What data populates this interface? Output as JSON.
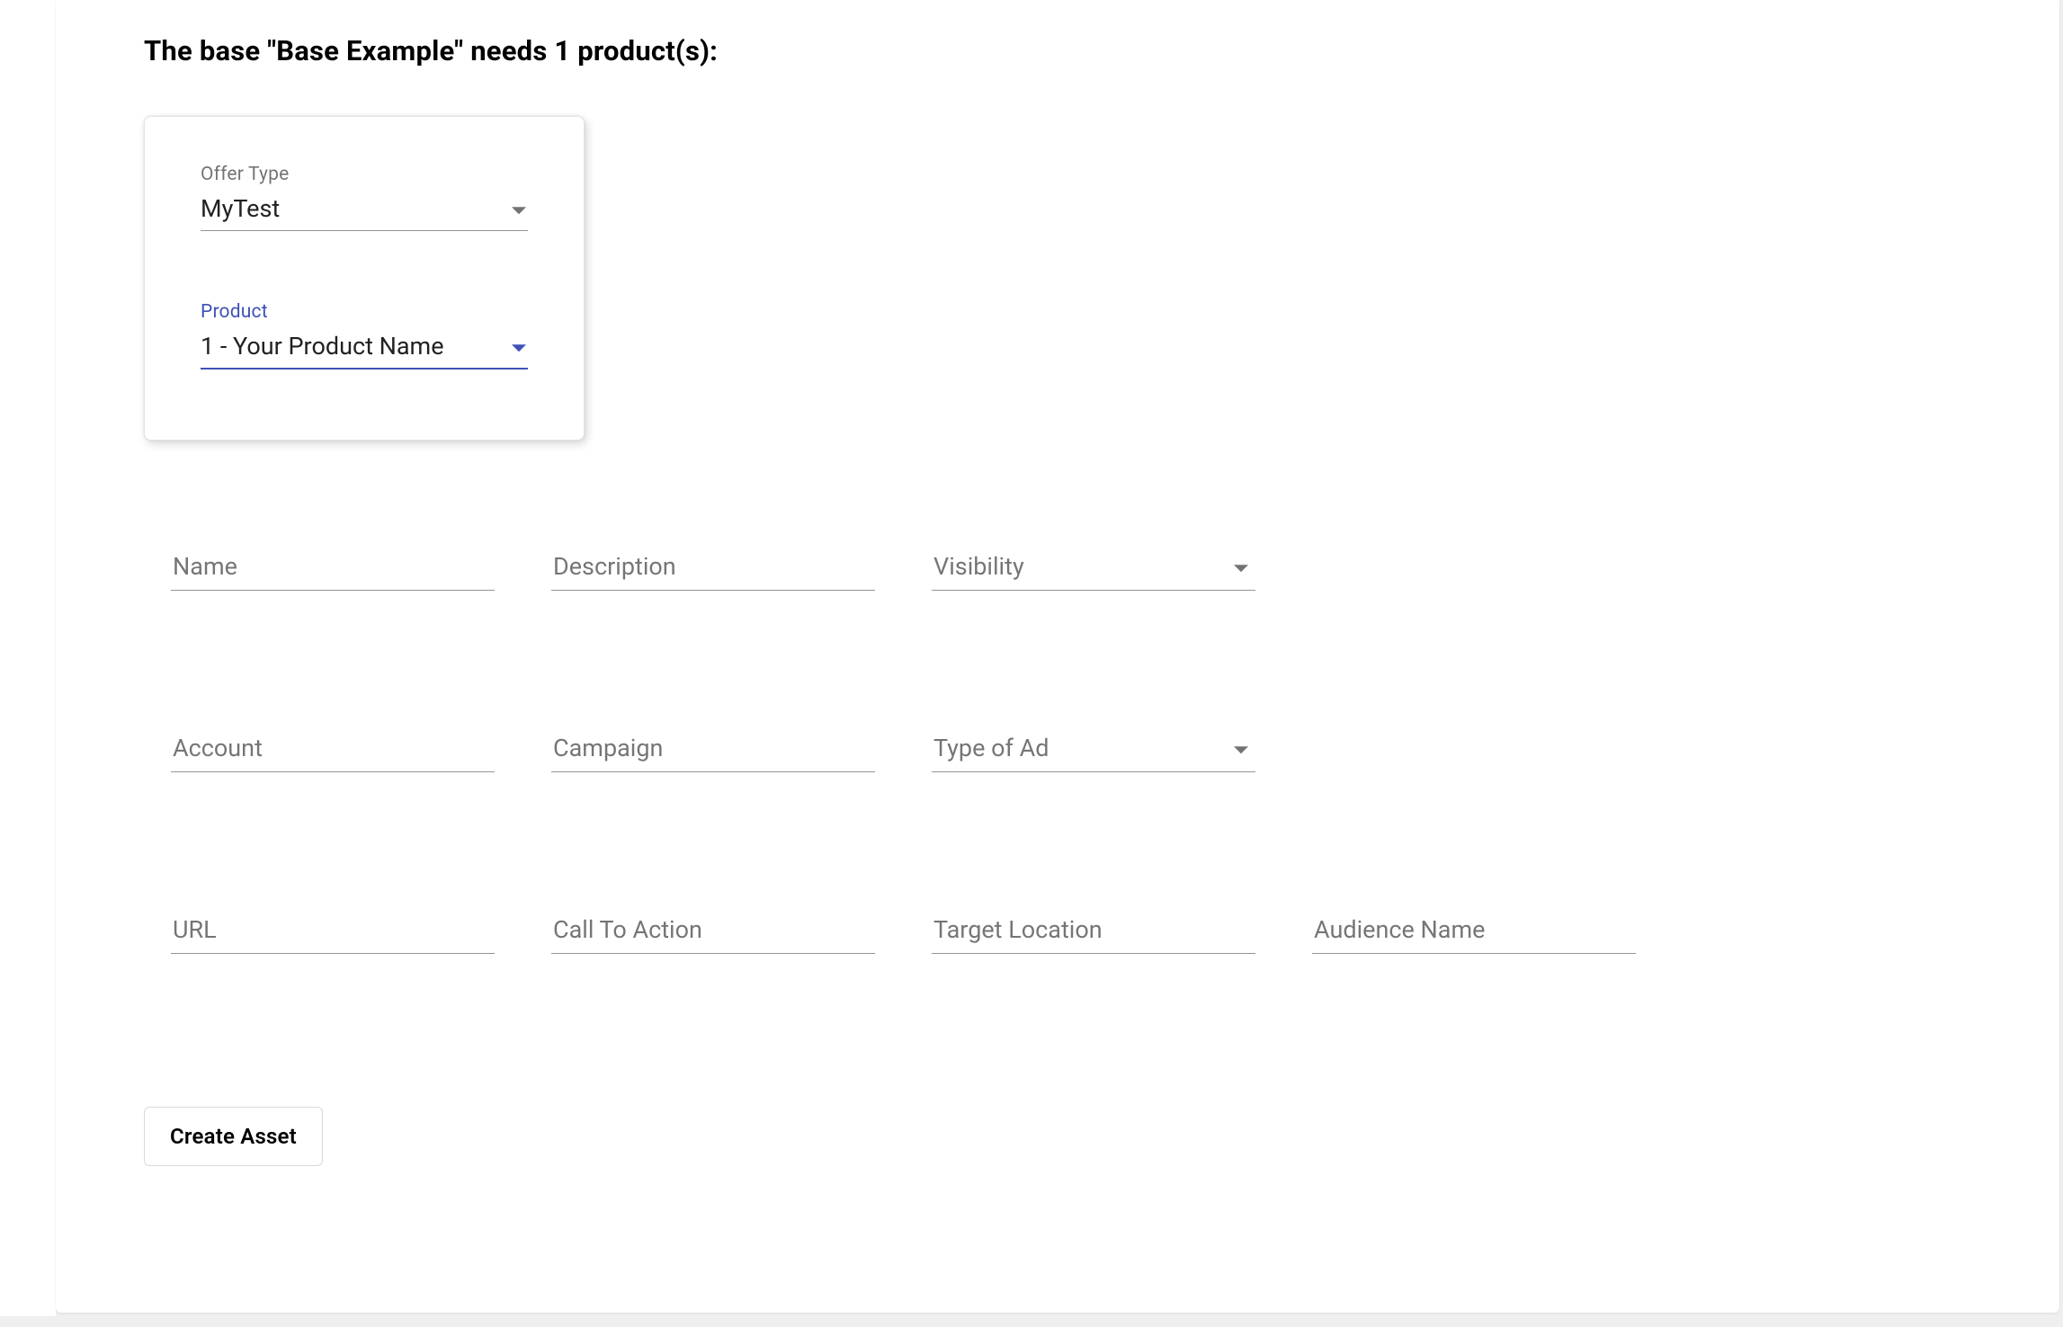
{
  "heading": "The base \"Base Example\" needs 1 product(s):",
  "card": {
    "offerType": {
      "label": "Offer Type",
      "value": "MyTest"
    },
    "product": {
      "label": "Product",
      "value": "1 - Your Product Name"
    }
  },
  "form": {
    "name": {
      "placeholder": "Name"
    },
    "description": {
      "placeholder": "Description"
    },
    "visibility": {
      "placeholder": "Visibility"
    },
    "account": {
      "placeholder": "Account"
    },
    "campaign": {
      "placeholder": "Campaign"
    },
    "typeOfAd": {
      "placeholder": "Type of Ad"
    },
    "url": {
      "placeholder": "URL"
    },
    "callToAction": {
      "placeholder": "Call To Action"
    },
    "targetLocation": {
      "placeholder": "Target Location"
    },
    "audienceName": {
      "placeholder": "Audience Name"
    }
  },
  "buttons": {
    "createAsset": "Create Asset"
  }
}
